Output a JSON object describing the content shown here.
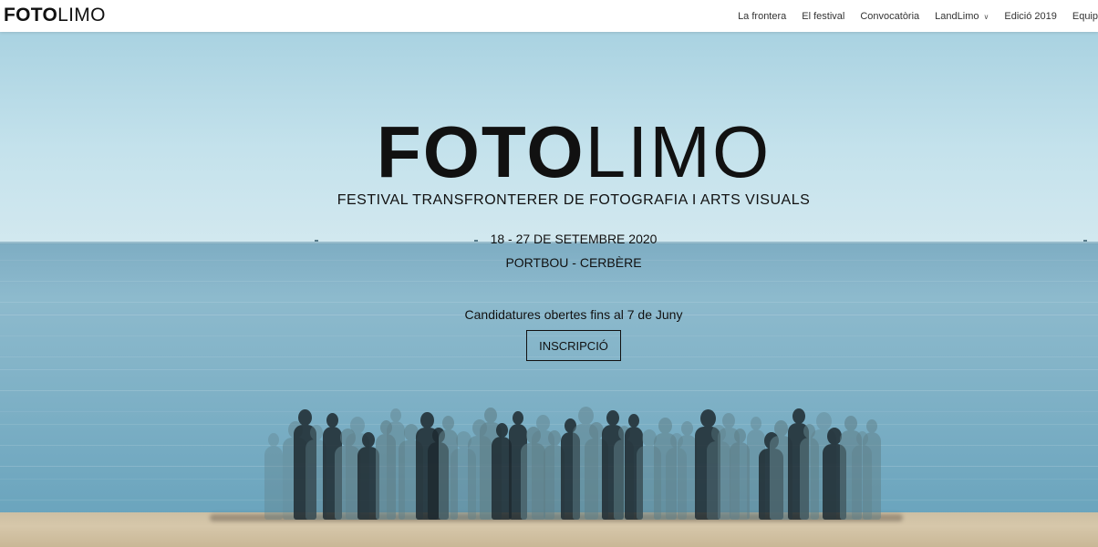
{
  "header": {
    "logo_bold": "FOTO",
    "logo_light": "LIMO",
    "nav": [
      {
        "label": "La frontera"
      },
      {
        "label": "El festival"
      },
      {
        "label": "Convocatòria"
      },
      {
        "label": "LandLimo",
        "icon": "chevron-down-icon"
      },
      {
        "label": "Edició 2019"
      },
      {
        "label": "Equip"
      }
    ]
  },
  "hero": {
    "title_bold": "FOTO",
    "title_light": "LIMO",
    "subtitle": "FESTIVAL TRANSFRONTERER DE FOTOGRAFIA I ARTS VISUALS",
    "dates": "18 - 27 DE SETEMBRE 2020",
    "place": "PORTBOU - CERBÈRE",
    "cta_text": "Candidatures obertes fins al 7 de Juny",
    "cta_button": "INSCRIPCIÓ"
  },
  "colors": {
    "text": "#111111",
    "header_bg": "#ffffff",
    "sky": "#c4e2ec",
    "sea": "#7fb1c6",
    "sand": "#d6c7aa"
  }
}
